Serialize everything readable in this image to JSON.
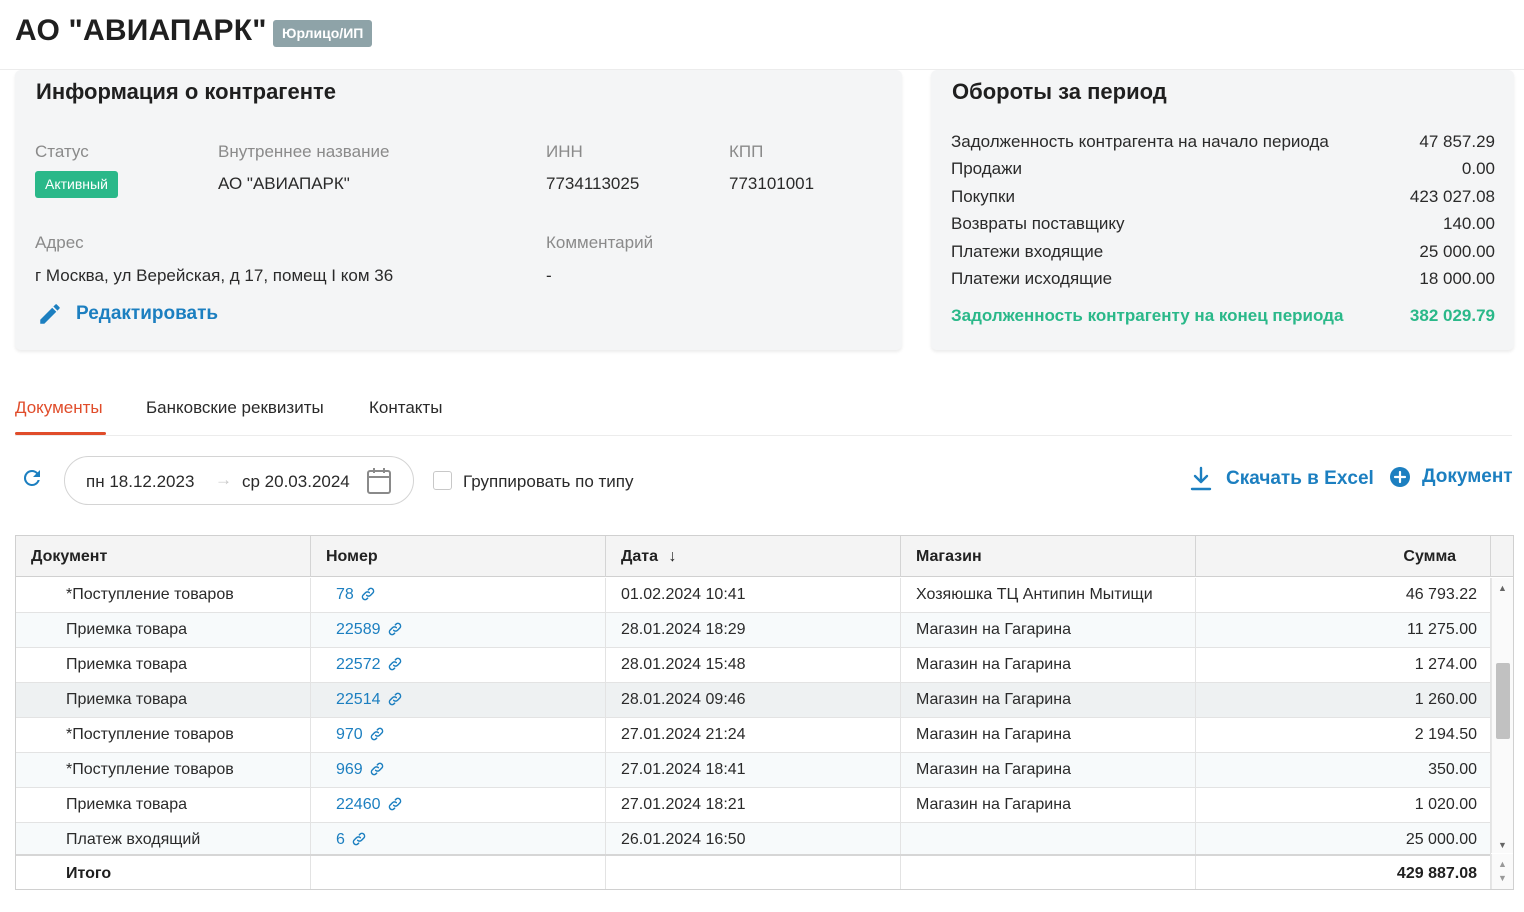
{
  "header": {
    "title": "АО \"АВИАПАРК\"",
    "type_badge": "Юрлицо/ИП"
  },
  "info_card": {
    "title": "Информация о контрагенте",
    "status_label": "Статус",
    "status_value": "Активный",
    "internal_name_label": "Внутреннее название",
    "internal_name_value": "АО \"АВИАПАРК\"",
    "inn_label": "ИНН",
    "inn_value": "7734113025",
    "kpp_label": "КПП",
    "kpp_value": "773101001",
    "address_label": "Адрес",
    "address_value": "г Москва, ул Верейская, д 17, помещ I ком 36",
    "comment_label": "Комментарий",
    "comment_value": "-",
    "edit_label": "Редактировать"
  },
  "turnover_card": {
    "title": "Обороты за период",
    "rows": [
      {
        "label": "Задолженность контрагента на начало периода",
        "value": "47 857.29"
      },
      {
        "label": "Продажи",
        "value": "0.00"
      },
      {
        "label": "Покупки",
        "value": "423 027.08"
      },
      {
        "label": "Возвраты поставщику",
        "value": "140.00"
      },
      {
        "label": "Платежи входящие",
        "value": "25 000.00"
      },
      {
        "label": "Платежи исходящие",
        "value": "18 000.00"
      }
    ],
    "total": {
      "label": "Задолженность контрагенту на конец периода",
      "value": "382 029.79"
    }
  },
  "tabs": [
    {
      "label": "Документы",
      "active": true
    },
    {
      "label": "Банковские реквизиты",
      "active": false
    },
    {
      "label": "Контакты",
      "active": false
    }
  ],
  "toolbar": {
    "date_from": "пн 18.12.2023",
    "date_arrow": "→",
    "date_to": "ср 20.03.2024",
    "group_by_type_label": "Группировать по типу",
    "group_by_type_checked": false,
    "excel_label": "Скачать в Excel",
    "new_document_label": "Документ"
  },
  "table": {
    "columns": [
      "Документ",
      "Номер",
      "Дата",
      "Магазин",
      "Сумма"
    ],
    "sort_icon": "arrow-down",
    "rows": [
      {
        "document": "*Поступление товаров",
        "number": "78",
        "date": "01.02.2024 10:41",
        "store": "Хозяюшка ТЦ Антипин Мытищи",
        "sum": "46 793.22"
      },
      {
        "document": "Приемка товара",
        "number": "22589",
        "date": "28.01.2024 18:29",
        "store": "Магазин на Гагарина",
        "sum": "11 275.00"
      },
      {
        "document": "Приемка товара",
        "number": "22572",
        "date": "28.01.2024 15:48",
        "store": "Магазин на Гагарина",
        "sum": "1 274.00"
      },
      {
        "document": "Приемка товара",
        "number": "22514",
        "date": "28.01.2024 09:46",
        "store": "Магазин на Гагарина",
        "sum": "1 260.00"
      },
      {
        "document": "*Поступление товаров",
        "number": "970",
        "date": "27.01.2024 21:24",
        "store": "Магазин на Гагарина",
        "sum": "2 194.50"
      },
      {
        "document": "*Поступление товаров",
        "number": "969",
        "date": "27.01.2024 18:41",
        "store": "Магазин на Гагарина",
        "sum": "350.00"
      },
      {
        "document": "Приемка товара",
        "number": "22460",
        "date": "27.01.2024 18:21",
        "store": "Магазин на Гагарина",
        "sum": "1 020.00"
      },
      {
        "document": "Платеж входящий",
        "number": "6",
        "date": "26.01.2024 16:50",
        "store": "",
        "sum": "25 000.00"
      }
    ],
    "footer": {
      "label": "Итого",
      "sum": "429 887.08"
    }
  },
  "colors": {
    "accent_blue": "#1c7fc0",
    "active_green": "#2ab889",
    "tab_active": "#e04c2a",
    "badge_gray": "#8ea3a8"
  }
}
